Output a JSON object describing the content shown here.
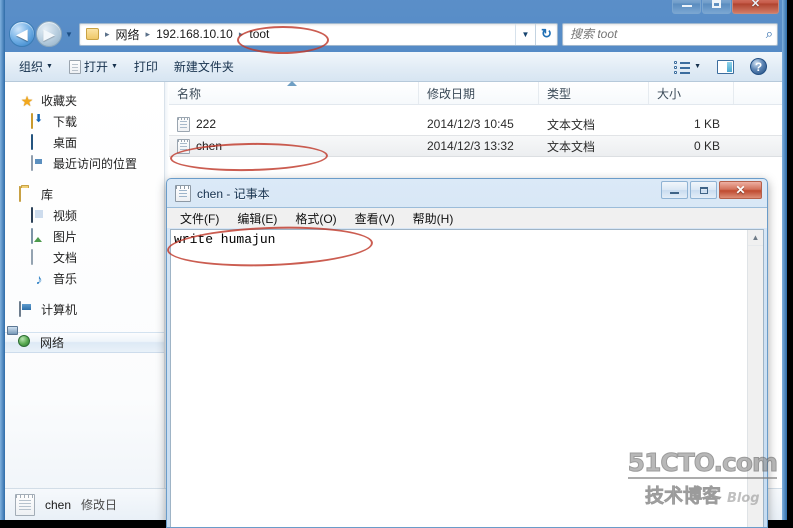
{
  "explorer": {
    "caption_buttons": [
      {
        "name": "minimize",
        "label": ""
      },
      {
        "name": "maximize",
        "label": ""
      },
      {
        "name": "close",
        "label": "✕"
      }
    ],
    "address": {
      "breadcrumb": [
        "网络",
        "192.168.10.10",
        "toot"
      ],
      "separator": "▸",
      "dropdown_glyph": "▼",
      "refresh_glyph": "↻"
    },
    "search": {
      "placeholder": "搜索 toot",
      "value": "",
      "icon": "search-icon",
      "icon_glyph": "🔍"
    },
    "toolbar": {
      "organize_label": "组织",
      "open_label": "打开",
      "print_label": "打印",
      "new_folder_label": "新建文件夹",
      "caret_glyph": "▼",
      "help_glyph": "?"
    },
    "sidebar": {
      "groups": [
        {
          "header": {
            "label": "收藏夹",
            "icon": "star-icon"
          },
          "items": [
            {
              "label": "下载",
              "icon": "download-icon"
            },
            {
              "label": "桌面",
              "icon": "desktop-icon"
            },
            {
              "label": "最近访问的位置",
              "icon": "recent-places-icon"
            }
          ]
        },
        {
          "header": {
            "label": "库",
            "icon": "library-icon"
          },
          "items": [
            {
              "label": "视频",
              "icon": "video-icon"
            },
            {
              "label": "图片",
              "icon": "picture-icon"
            },
            {
              "label": "文档",
              "icon": "document-icon"
            },
            {
              "label": "音乐",
              "icon": "music-icon"
            }
          ]
        },
        {
          "header": {
            "label": "计算机",
            "icon": "computer-icon"
          },
          "items": []
        }
      ],
      "selected_item": {
        "label": "网络",
        "icon": "network-icon"
      }
    },
    "filelist": {
      "columns": [
        "名称",
        "修改日期",
        "类型",
        "大小"
      ],
      "sort_column": "名称",
      "sort_direction": "ascending",
      "rows": [
        {
          "name": "222",
          "date": "2014/12/3 10:45",
          "type": "文本文档",
          "size": "1 KB",
          "selected": false
        },
        {
          "name": "chen",
          "date": "2014/12/3 13:32",
          "type": "文本文档",
          "size": "0 KB",
          "selected": true
        }
      ]
    },
    "statusbar": {
      "file_name": "chen",
      "detail_label": "修改日"
    }
  },
  "notepad": {
    "title": "chen - 记事本",
    "menus": [
      "文件(F)",
      "编辑(E)",
      "格式(O)",
      "查看(V)",
      "帮助(H)"
    ],
    "content": "write humajun",
    "caption_buttons": [
      {
        "name": "minimize",
        "label": ""
      },
      {
        "name": "maximize",
        "label": ""
      },
      {
        "name": "close",
        "label": "✕"
      }
    ],
    "scroll_up_glyph": "▲"
  },
  "annotations": {
    "circles": [
      "toot-breadcrumb",
      "chen-file-row",
      "write-humajun-text"
    ],
    "color": "#c0392b"
  },
  "watermark": {
    "top": "51CTO.com",
    "bottom_cn": "技术博客",
    "bottom_en": "Blog"
  }
}
